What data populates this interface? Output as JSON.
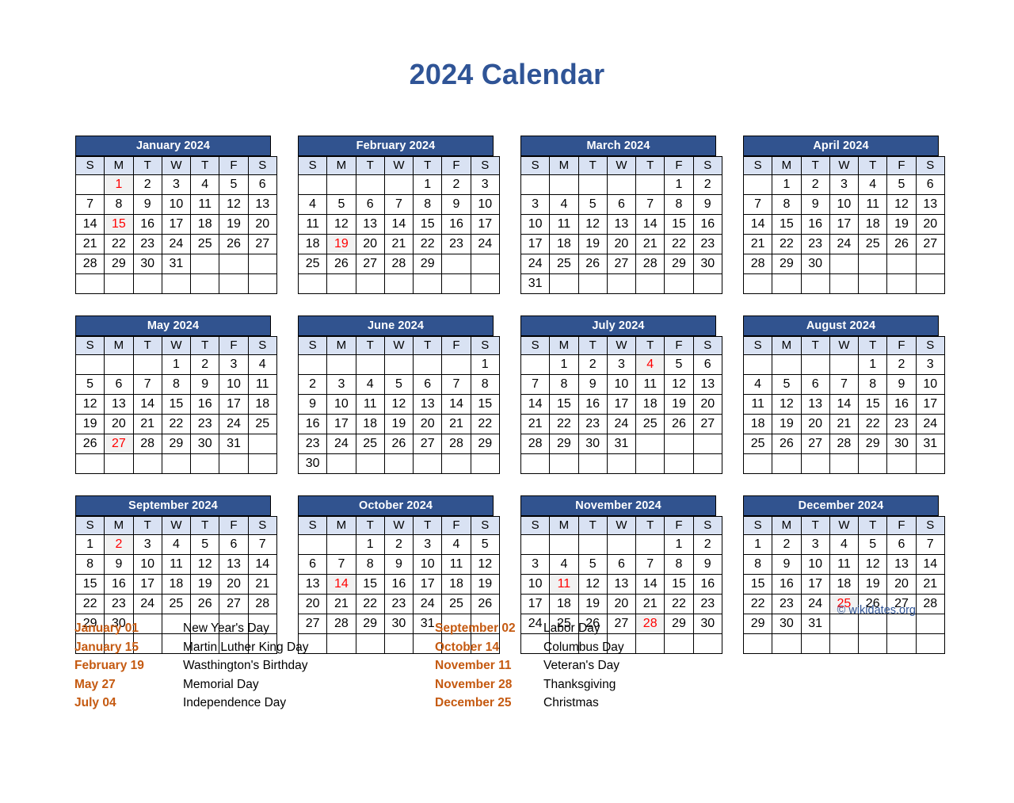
{
  "page": {
    "title": "2024 Calendar",
    "copyright": "© wikidates.org"
  },
  "colors": {
    "title": "#2f5496",
    "month_header_bg": "#31538f",
    "month_header_text": "#ffffff",
    "weekday_bg": "#d9e2f3",
    "holiday_text": "#ff0000",
    "holiday_cell_bg": "#f2f2f2",
    "legend_date": "#c55a11",
    "grid_border": "#000000",
    "copyright_text": "#2f5496"
  },
  "weekdays": [
    "S",
    "M",
    "T",
    "W",
    "T",
    "F",
    "S"
  ],
  "months": [
    {
      "name": "January 2024",
      "weeks": [
        [
          "",
          "1",
          "2",
          "3",
          "4",
          "5",
          "6"
        ],
        [
          "7",
          "8",
          "9",
          "10",
          "11",
          "12",
          "13"
        ],
        [
          "14",
          "15",
          "16",
          "17",
          "18",
          "19",
          "20"
        ],
        [
          "21",
          "22",
          "23",
          "24",
          "25",
          "26",
          "27"
        ],
        [
          "28",
          "29",
          "30",
          "31",
          "",
          "",
          ""
        ],
        [
          "",
          "",
          "",
          "",
          "",
          "",
          ""
        ]
      ],
      "holidays": [
        "1",
        "15"
      ]
    },
    {
      "name": "February 2024",
      "weeks": [
        [
          "",
          "",
          "",
          "",
          "1",
          "2",
          "3"
        ],
        [
          "4",
          "5",
          "6",
          "7",
          "8",
          "9",
          "10"
        ],
        [
          "11",
          "12",
          "13",
          "14",
          "15",
          "16",
          "17"
        ],
        [
          "18",
          "19",
          "20",
          "21",
          "22",
          "23",
          "24"
        ],
        [
          "25",
          "26",
          "27",
          "28",
          "29",
          "",
          ""
        ],
        [
          "",
          "",
          "",
          "",
          "",
          "",
          ""
        ]
      ],
      "holidays": [
        "19"
      ]
    },
    {
      "name": "March 2024",
      "weeks": [
        [
          "",
          "",
          "",
          "",
          "",
          "1",
          "2"
        ],
        [
          "3",
          "4",
          "5",
          "6",
          "7",
          "8",
          "9"
        ],
        [
          "10",
          "11",
          "12",
          "13",
          "14",
          "15",
          "16"
        ],
        [
          "17",
          "18",
          "19",
          "20",
          "21",
          "22",
          "23"
        ],
        [
          "24",
          "25",
          "26",
          "27",
          "28",
          "29",
          "30"
        ],
        [
          "31",
          "",
          "",
          "",
          "",
          "",
          ""
        ]
      ],
      "holidays": []
    },
    {
      "name": "April 2024",
      "weeks": [
        [
          "",
          "1",
          "2",
          "3",
          "4",
          "5",
          "6"
        ],
        [
          "7",
          "8",
          "9",
          "10",
          "11",
          "12",
          "13"
        ],
        [
          "14",
          "15",
          "16",
          "17",
          "18",
          "19",
          "20"
        ],
        [
          "21",
          "22",
          "23",
          "24",
          "25",
          "26",
          "27"
        ],
        [
          "28",
          "29",
          "30",
          "",
          "",
          "",
          ""
        ],
        [
          "",
          "",
          "",
          "",
          "",
          "",
          ""
        ]
      ],
      "holidays": []
    },
    {
      "name": "May 2024",
      "weeks": [
        [
          "",
          "",
          "",
          "1",
          "2",
          "3",
          "4"
        ],
        [
          "5",
          "6",
          "7",
          "8",
          "9",
          "10",
          "11"
        ],
        [
          "12",
          "13",
          "14",
          "15",
          "16",
          "17",
          "18"
        ],
        [
          "19",
          "20",
          "21",
          "22",
          "23",
          "24",
          "25"
        ],
        [
          "26",
          "27",
          "28",
          "29",
          "30",
          "31",
          ""
        ],
        [
          "",
          "",
          "",
          "",
          "",
          "",
          ""
        ]
      ],
      "holidays": [
        "27"
      ]
    },
    {
      "name": "June 2024",
      "weeks": [
        [
          "",
          "",
          "",
          "",
          "",
          "",
          "1"
        ],
        [
          "2",
          "3",
          "4",
          "5",
          "6",
          "7",
          "8"
        ],
        [
          "9",
          "10",
          "11",
          "12",
          "13",
          "14",
          "15"
        ],
        [
          "16",
          "17",
          "18",
          "19",
          "20",
          "21",
          "22"
        ],
        [
          "23",
          "24",
          "25",
          "26",
          "27",
          "28",
          "29"
        ],
        [
          "30",
          "",
          "",
          "",
          "",
          "",
          ""
        ]
      ],
      "holidays": []
    },
    {
      "name": "July 2024",
      "weeks": [
        [
          "",
          "1",
          "2",
          "3",
          "4",
          "5",
          "6"
        ],
        [
          "7",
          "8",
          "9",
          "10",
          "11",
          "12",
          "13"
        ],
        [
          "14",
          "15",
          "16",
          "17",
          "18",
          "19",
          "20"
        ],
        [
          "21",
          "22",
          "23",
          "24",
          "25",
          "26",
          "27"
        ],
        [
          "28",
          "29",
          "30",
          "31",
          "",
          "",
          ""
        ],
        [
          "",
          "",
          "",
          "",
          "",
          "",
          ""
        ]
      ],
      "holidays": [
        "4"
      ]
    },
    {
      "name": "August 2024",
      "weeks": [
        [
          "",
          "",
          "",
          "",
          "1",
          "2",
          "3"
        ],
        [
          "4",
          "5",
          "6",
          "7",
          "8",
          "9",
          "10"
        ],
        [
          "11",
          "12",
          "13",
          "14",
          "15",
          "16",
          "17"
        ],
        [
          "18",
          "19",
          "20",
          "21",
          "22",
          "23",
          "24"
        ],
        [
          "25",
          "26",
          "27",
          "28",
          "29",
          "30",
          "31"
        ],
        [
          "",
          "",
          "",
          "",
          "",
          "",
          ""
        ]
      ],
      "holidays": []
    },
    {
      "name": "September 2024",
      "weeks": [
        [
          "1",
          "2",
          "3",
          "4",
          "5",
          "6",
          "7"
        ],
        [
          "8",
          "9",
          "10",
          "11",
          "12",
          "13",
          "14"
        ],
        [
          "15",
          "16",
          "17",
          "18",
          "19",
          "20",
          "21"
        ],
        [
          "22",
          "23",
          "24",
          "25",
          "26",
          "27",
          "28"
        ],
        [
          "29",
          "30",
          "",
          "",
          "",
          "",
          ""
        ],
        [
          "",
          "",
          "",
          "",
          "",
          "",
          ""
        ]
      ],
      "holidays": [
        "2"
      ]
    },
    {
      "name": "October 2024",
      "weeks": [
        [
          "",
          "",
          "1",
          "2",
          "3",
          "4",
          "5"
        ],
        [
          "6",
          "7",
          "8",
          "9",
          "10",
          "11",
          "12"
        ],
        [
          "13",
          "14",
          "15",
          "16",
          "17",
          "18",
          "19"
        ],
        [
          "20",
          "21",
          "22",
          "23",
          "24",
          "25",
          "26"
        ],
        [
          "27",
          "28",
          "29",
          "30",
          "31",
          "",
          ""
        ],
        [
          "",
          "",
          "",
          "",
          "",
          "",
          ""
        ]
      ],
      "holidays": [
        "14"
      ]
    },
    {
      "name": "November 2024",
      "weeks": [
        [
          "",
          "",
          "",
          "",
          "",
          "1",
          "2"
        ],
        [
          "3",
          "4",
          "5",
          "6",
          "7",
          "8",
          "9"
        ],
        [
          "10",
          "11",
          "12",
          "13",
          "14",
          "15",
          "16"
        ],
        [
          "17",
          "18",
          "19",
          "20",
          "21",
          "22",
          "23"
        ],
        [
          "24",
          "25",
          "26",
          "27",
          "28",
          "29",
          "30"
        ],
        [
          "",
          "",
          "",
          "",
          "",
          "",
          ""
        ]
      ],
      "holidays": [
        "11",
        "28"
      ]
    },
    {
      "name": "December 2024",
      "weeks": [
        [
          "1",
          "2",
          "3",
          "4",
          "5",
          "6",
          "7"
        ],
        [
          "8",
          "9",
          "10",
          "11",
          "12",
          "13",
          "14"
        ],
        [
          "15",
          "16",
          "17",
          "18",
          "19",
          "20",
          "21"
        ],
        [
          "22",
          "23",
          "24",
          "25",
          "26",
          "27",
          "28"
        ],
        [
          "29",
          "30",
          "31",
          "",
          "",
          "",
          ""
        ],
        [
          "",
          "",
          "",
          "",
          "",
          "",
          ""
        ]
      ],
      "holidays": [
        "25"
      ]
    }
  ],
  "legend": {
    "columns": [
      [
        {
          "date": "January 01",
          "name": "New Year's Day"
        },
        {
          "date": "January 15",
          "name": "Martin Luther King Day"
        },
        {
          "date": "February 19",
          "name": "Wasthington's Birthday"
        },
        {
          "date": "May 27",
          "name": "Memorial Day"
        },
        {
          "date": "July 04",
          "name": "Independence Day"
        }
      ],
      [
        {
          "date": "September 02",
          "name": "Labor Day"
        },
        {
          "date": "October 14",
          "name": "Columbus Day"
        },
        {
          "date": "November 11",
          "name": "Veteran's Day"
        },
        {
          "date": "November 28",
          "name": "Thanksgiving"
        },
        {
          "date": "December 25",
          "name": "Christmas"
        }
      ]
    ]
  }
}
